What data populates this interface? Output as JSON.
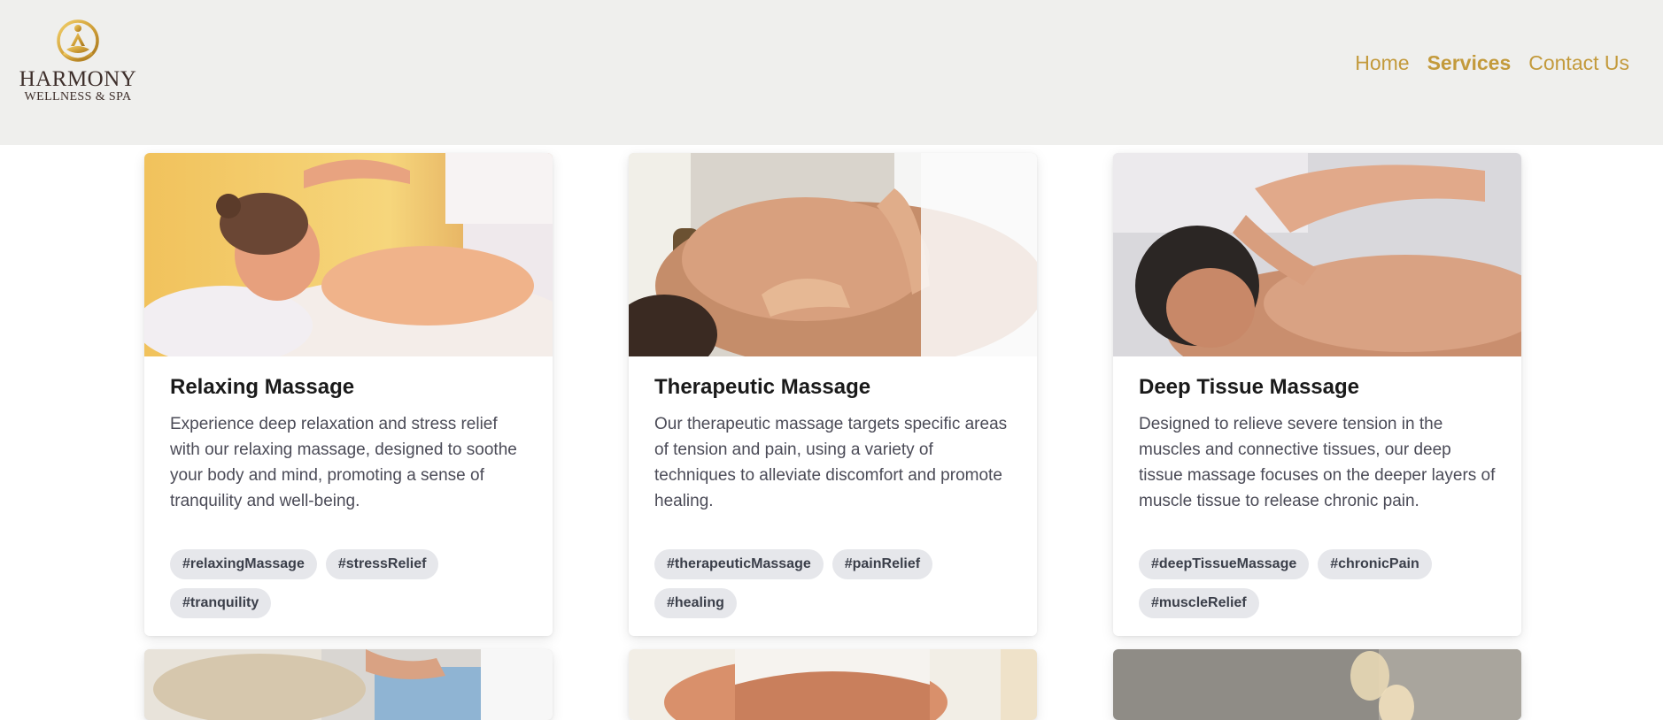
{
  "brand": {
    "name": "HARMONY",
    "subtitle": "WELLNESS & SPA",
    "accent": "#c39a3c"
  },
  "nav": {
    "items": [
      {
        "label": "Home",
        "active": false
      },
      {
        "label": "Services",
        "active": true
      },
      {
        "label": "Contact Us",
        "active": false
      }
    ]
  },
  "cards": [
    {
      "title": "Relaxing Massage",
      "description": "Experience deep relaxation and stress relief with our relaxing massage, designed to soothe your body and mind, promoting a sense of tranquility and well-being.",
      "tags": [
        "#relaxingMassage",
        "#stressRelief",
        "#tranquility"
      ]
    },
    {
      "title": "Therapeutic Massage",
      "description": "Our therapeutic massage targets specific areas of tension and pain, using a variety of techniques to alleviate discomfort and promote healing.",
      "tags": [
        "#therapeuticMassage",
        "#painRelief",
        "#healing"
      ]
    },
    {
      "title": "Deep Tissue Massage",
      "description": "Designed to relieve severe tension in the muscles and connective tissues, our deep tissue massage focuses on the deeper layers of muscle tissue to release chronic pain.",
      "tags": [
        "#deepTissueMassage",
        "#chronicPain",
        "#muscleRelief"
      ]
    }
  ]
}
